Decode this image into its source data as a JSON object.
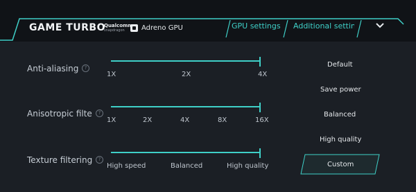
{
  "header": {
    "title": "GAME TURBO",
    "brand_line1": "Qualcomm",
    "brand_line2": "snapdragon",
    "gpu": "Adreno GPU",
    "tabs": [
      {
        "label": "GPU settings",
        "active": true
      },
      {
        "label": "Additional settings",
        "active": false
      }
    ],
    "menu_icon": "chevron-down-icon"
  },
  "settings": {
    "anti_aliasing": {
      "label": "Anti-aliasing",
      "ticks": [
        "1X",
        "2X",
        "4X"
      ],
      "selected": "4X"
    },
    "anisotropic": {
      "label": "Anisotropic filte",
      "ticks": [
        "1X",
        "2X",
        "4X",
        "8X",
        "16X"
      ],
      "selected": "16X"
    },
    "texture": {
      "label": "Texture filtering",
      "ticks": [
        "High speed",
        "Balanced",
        "High quality"
      ],
      "selected": "High quality"
    }
  },
  "presets": {
    "options": [
      "Default",
      "Save power",
      "Balanced",
      "High quality",
      "Custom"
    ],
    "selected": "Custom"
  },
  "colors": {
    "accent": "#3fd0c8",
    "background": "#1b1f25",
    "header": "#101317"
  }
}
